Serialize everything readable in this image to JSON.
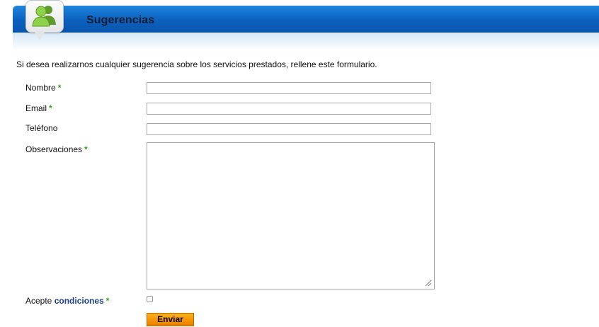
{
  "header": {
    "title": "Sugerencias",
    "icon": "users-icon"
  },
  "intro_text": "Si desea realizarnos cualquier sugerencia sobre los servicios prestados, rellene este formulario.",
  "form": {
    "required_marker": "*",
    "fields": [
      {
        "label": "Nombre",
        "required": true,
        "value": ""
      },
      {
        "label": "Email",
        "required": true,
        "value": ""
      },
      {
        "label": "Teléfono",
        "required": false,
        "value": ""
      }
    ],
    "observaciones": {
      "label": "Observaciones",
      "required": true,
      "value": ""
    },
    "terms": {
      "label_prefix": "Acepte",
      "link_text": "condiciones",
      "required": true,
      "checked": false
    },
    "submit_label": "Enviar"
  },
  "colors": {
    "header_blue": "#0b61bd",
    "required_green": "#3aa21b",
    "link_blue": "#1d3f8e",
    "button_orange": "#f59200"
  }
}
